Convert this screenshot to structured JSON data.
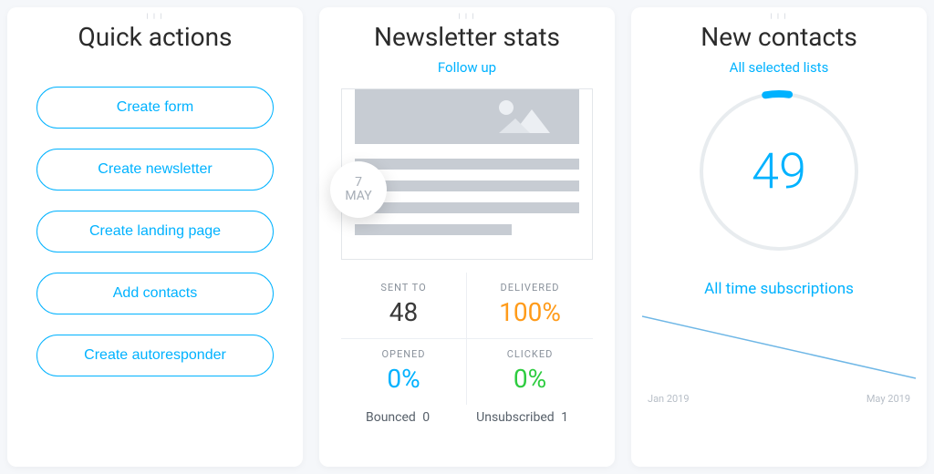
{
  "quick_actions": {
    "title": "Quick actions",
    "buttons": [
      "Create form",
      "Create newsletter",
      "Create landing page",
      "Add contacts",
      "Create autoresponder"
    ]
  },
  "newsletter_stats": {
    "title": "Newsletter stats",
    "subtitle": "Follow up",
    "date_day": "7",
    "date_month": "MAY",
    "sent_to_label": "SENT TO",
    "sent_to_value": "48",
    "delivered_label": "DELIVERED",
    "delivered_value": "100%",
    "opened_label": "OPENED",
    "opened_value": "0%",
    "clicked_label": "CLICKED",
    "clicked_value": "0%",
    "bounced_label": "Bounced",
    "bounced_value": "0",
    "unsub_label": "Unsubscribed",
    "unsub_value": "1"
  },
  "new_contacts": {
    "title": "New contacts",
    "subtitle": "All selected lists",
    "count": "49",
    "link": "All time subscriptions",
    "axis_start": "Jan 2019",
    "axis_end": "May 2019"
  }
}
